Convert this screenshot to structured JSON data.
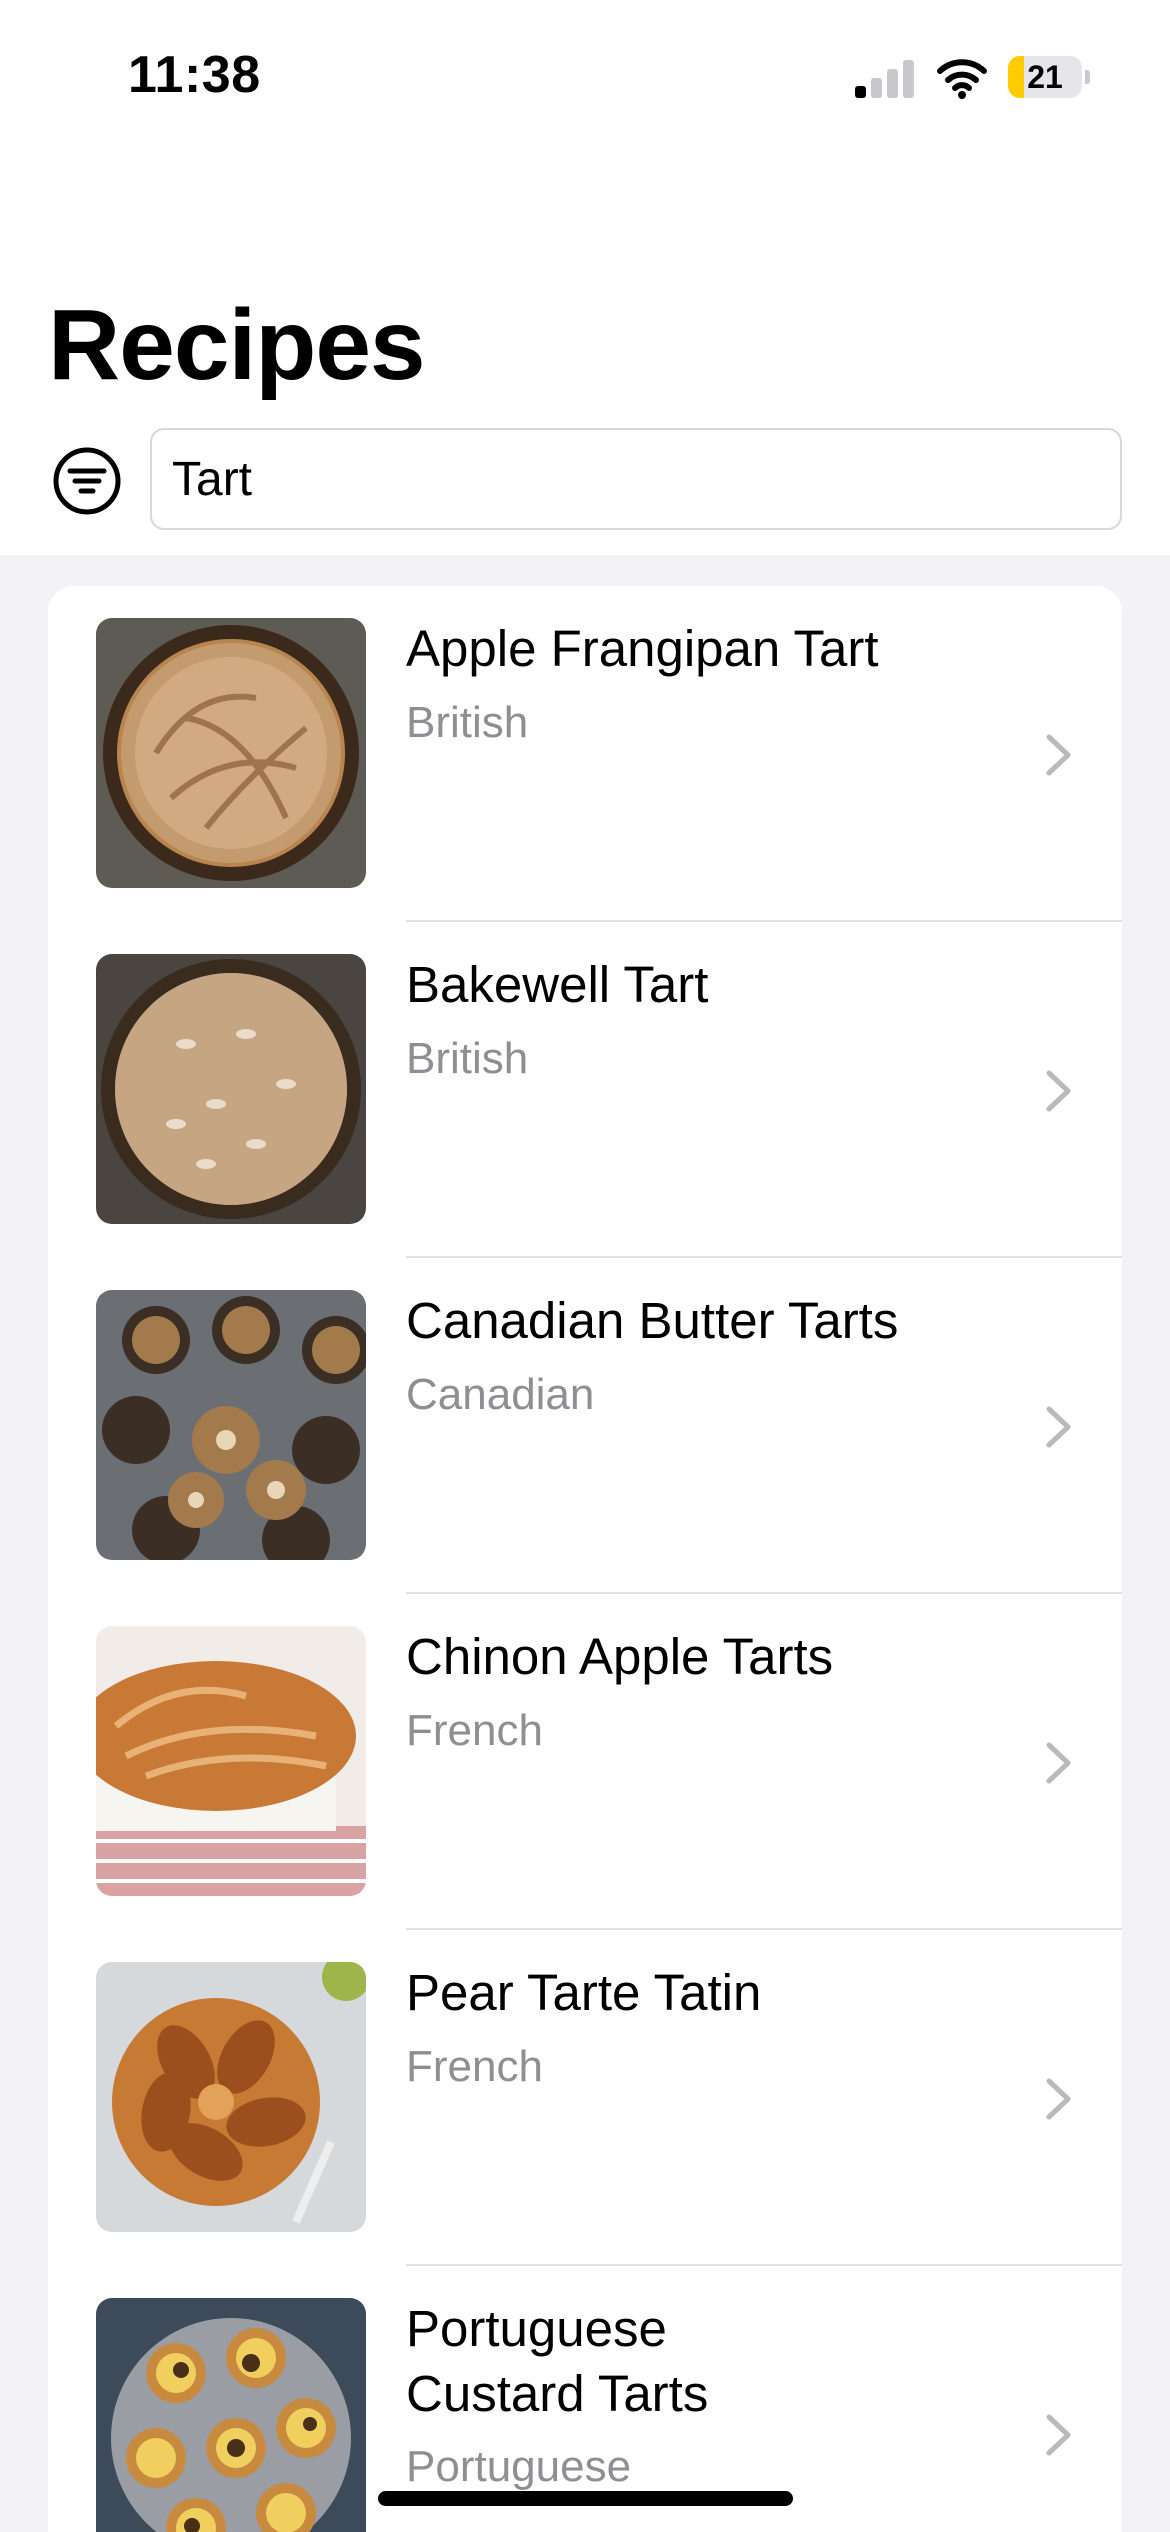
{
  "status_bar": {
    "time": "11:38",
    "battery_level": "21",
    "battery_fraction": 0.21,
    "signal_bars_active": 1,
    "signal_bars_total": 4,
    "signal_icon": "cellular-signal-icon",
    "wifi_icon": "wifi-icon",
    "battery_icon": "battery-icon"
  },
  "header": {
    "title": "Recipes"
  },
  "search": {
    "filter_icon": "filter-icon",
    "value": "Tart"
  },
  "recipes": [
    {
      "name": "Apple Frangipan Tart",
      "area": "British",
      "thumbnail_icon": "apple-frangipan-tart-photo"
    },
    {
      "name": "Bakewell Tart",
      "area": "British",
      "thumbnail_icon": "bakewell-tart-photo"
    },
    {
      "name": "Canadian Butter Tarts",
      "area": "Canadian",
      "thumbnail_icon": "canadian-butter-tarts-photo"
    },
    {
      "name": "Chinon Apple Tarts",
      "area": "French",
      "thumbnail_icon": "chinon-apple-tarts-photo"
    },
    {
      "name": "Pear Tarte Tatin",
      "area": "French",
      "thumbnail_icon": "pear-tarte-tatin-photo"
    },
    {
      "name": "Portuguese Custard Tarts",
      "area": "Portuguese",
      "thumbnail_icon": "portuguese-custard-tarts-photo"
    }
  ],
  "colors": {
    "background": "#f2f2f7",
    "secondary_text": "#8e8e93",
    "chevron": "#b8b8bd",
    "battery_low": "#ffcc00"
  }
}
